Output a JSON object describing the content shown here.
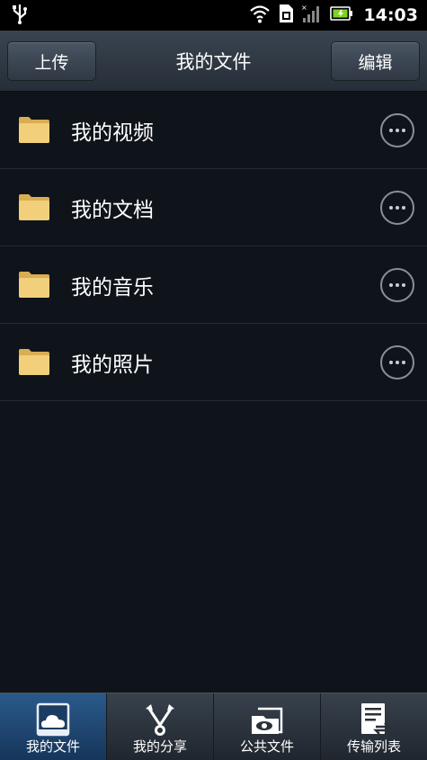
{
  "status_bar": {
    "time": "14:03",
    "icons": [
      "usb-icon",
      "wifi-icon",
      "sim-icon",
      "signal-icon",
      "battery-icon"
    ],
    "battery_color": "#7ed321"
  },
  "header": {
    "title": "我的文件",
    "upload_label": "上传",
    "edit_label": "编辑"
  },
  "files": [
    {
      "name": "我的视频",
      "icon": "folder-icon"
    },
    {
      "name": "我的文档",
      "icon": "folder-icon"
    },
    {
      "name": "我的音乐",
      "icon": "folder-icon"
    },
    {
      "name": "我的照片",
      "icon": "folder-icon"
    }
  ],
  "bottom_nav": {
    "tabs": [
      {
        "label": "我的文件",
        "icon": "cloud-files-icon",
        "active": true
      },
      {
        "label": "我的分享",
        "icon": "share-icon",
        "active": false
      },
      {
        "label": "公共文件",
        "icon": "public-folder-icon",
        "active": false
      },
      {
        "label": "传输列表",
        "icon": "transfer-list-icon",
        "active": false
      }
    ]
  },
  "colors": {
    "background": "#0f141b",
    "folder": "#f2cf7a",
    "active_tab": "#2a5a8a"
  }
}
